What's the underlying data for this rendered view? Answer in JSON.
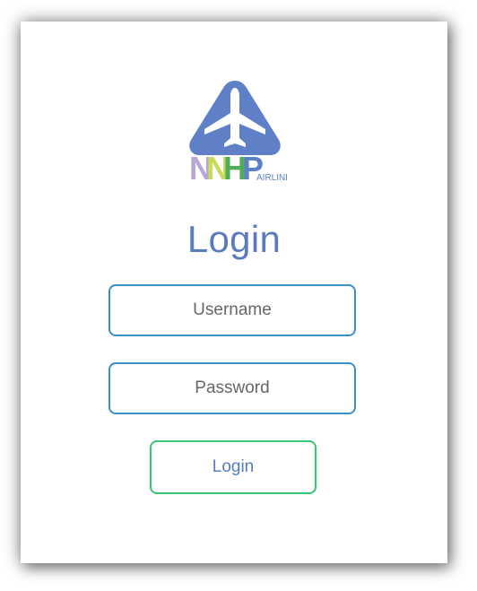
{
  "logo": {
    "letters": [
      "N",
      "N",
      "H",
      "P"
    ],
    "subtext": "AIRLINE",
    "colors": {
      "triangle": "#5f80c6",
      "plane": "#ffffff",
      "n1": "#b9a6d8",
      "n2": "#c8dc5a",
      "h": "#4fae5a",
      "p": "#5f80c6",
      "subtext": "#5f80c6"
    },
    "icon": "airplane-icon"
  },
  "title": "Login",
  "username": {
    "placeholder": "Username",
    "value": ""
  },
  "password": {
    "placeholder": "Password",
    "value": ""
  },
  "login_button": {
    "label": "Login"
  },
  "colors": {
    "accent": "#5b7cbc",
    "input_border": "#3d8fc8",
    "button_border": "#33c872"
  }
}
